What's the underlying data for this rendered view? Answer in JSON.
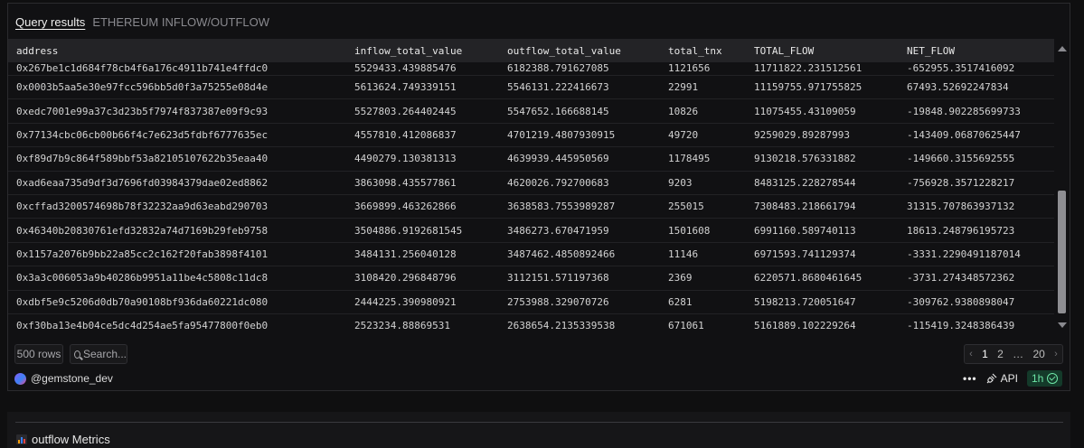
{
  "header": {
    "tab_label": "Query results",
    "subtitle": "ETHEREUM INFLOW/OUTFLOW"
  },
  "table": {
    "columns": [
      "address",
      "inflow_total_value",
      "outflow_total_value",
      "total_tnx",
      "TOTAL_FLOW",
      "NET_FLOW"
    ],
    "rows": [
      [
        "0x267be1c1d684f78cb4f6a176c4911b741e4ffdc0",
        "5529433.439885476",
        "6182388.791627085",
        "1121656",
        "11711822.231512561",
        "-652955.3517416092"
      ],
      [
        "0x0003b5aa5e30e97fcc596bb5d0f3a75255e08d4e",
        "5613624.749339151",
        "5546131.222416673",
        "22991",
        "11159755.971755825",
        "67493.52692247834"
      ],
      [
        "0xedc7001e99a37c3d23b5f7974f837387e09f9c93",
        "5527803.264402445",
        "5547652.166688145",
        "10826",
        "11075455.43109059",
        "-19848.902285699733"
      ],
      [
        "0x77134cbc06cb00b66f4c7e623d5fdbf6777635ec",
        "4557810.412086837",
        "4701219.4807930915",
        "49720",
        "9259029.89287993",
        "-143409.06870625447"
      ],
      [
        "0xf89d7b9c864f589bbf53a82105107622b35eaa40",
        "4490279.130381313",
        "4639939.445950569",
        "1178495",
        "9130218.576331882",
        "-149660.3155692555"
      ],
      [
        "0xad6eaa735d9df3d7696fd03984379dae02ed8862",
        "3863098.435577861",
        "4620026.792700683",
        "9203",
        "8483125.228278544",
        "-756928.3571228217"
      ],
      [
        "0xcffad3200574698b78f32232aa9d63eabd290703",
        "3669899.463262866",
        "3638583.7553989287",
        "255015",
        "7308483.218661794",
        "31315.707863937132"
      ],
      [
        "0x46340b20830761efd32832a74d7169b29feb9758",
        "3504886.9192681545",
        "3486273.670471959",
        "1501608",
        "6991160.589740113",
        "18613.248796195723"
      ],
      [
        "0x1157a2076b9bb22a85cc2c162f20fab3898f4101",
        "3484131.256040128",
        "3487462.4850892466",
        "11146",
        "6971593.741129374",
        "-3331.2290491187014"
      ],
      [
        "0x3a3c006053a9b40286b9951a11be4c5808c11dc8",
        "3108420.296848796",
        "3112151.571197368",
        "2369",
        "6220571.8680461645",
        "-3731.274348572362"
      ],
      [
        "0xdbf5e9c5206d0db70a90108bf936da60221dc080",
        "2444225.390980921",
        "2753988.329070726",
        "6281",
        "5198213.720051647",
        "-309762.9380898047"
      ],
      [
        "0xf30ba13e4b04ce5dc4d254ae5fa95477800f0eb0",
        "2523234.88869531",
        "2638654.2135339538",
        "671061",
        "5161889.102229264",
        "-115419.3248386439"
      ]
    ]
  },
  "footer": {
    "rows_count": "500 rows",
    "search_placeholder": "Search...",
    "pager": {
      "prev": "‹",
      "page_1": "1",
      "page_2": "2",
      "ellipsis": "…",
      "last_page": "20",
      "next": "›"
    }
  },
  "user": {
    "handle": "@gemstone_dev"
  },
  "actions": {
    "more": "•••",
    "api_label": "API",
    "refresh_label": "1h"
  },
  "bottom_panel": {
    "title": "outflow Metrics"
  },
  "colors": {
    "background": "#0f0f10",
    "panel": "#111113",
    "header_row": "#232326",
    "refresh_badge_bg": "#143a2a",
    "refresh_badge_fg": "#6ee7a7"
  },
  "icons": [
    "search-icon",
    "plug-icon",
    "check-circle-icon",
    "bar-chart-icon",
    "chevron-left-icon",
    "chevron-right-icon",
    "scroll-up-icon",
    "scroll-down-icon"
  ]
}
